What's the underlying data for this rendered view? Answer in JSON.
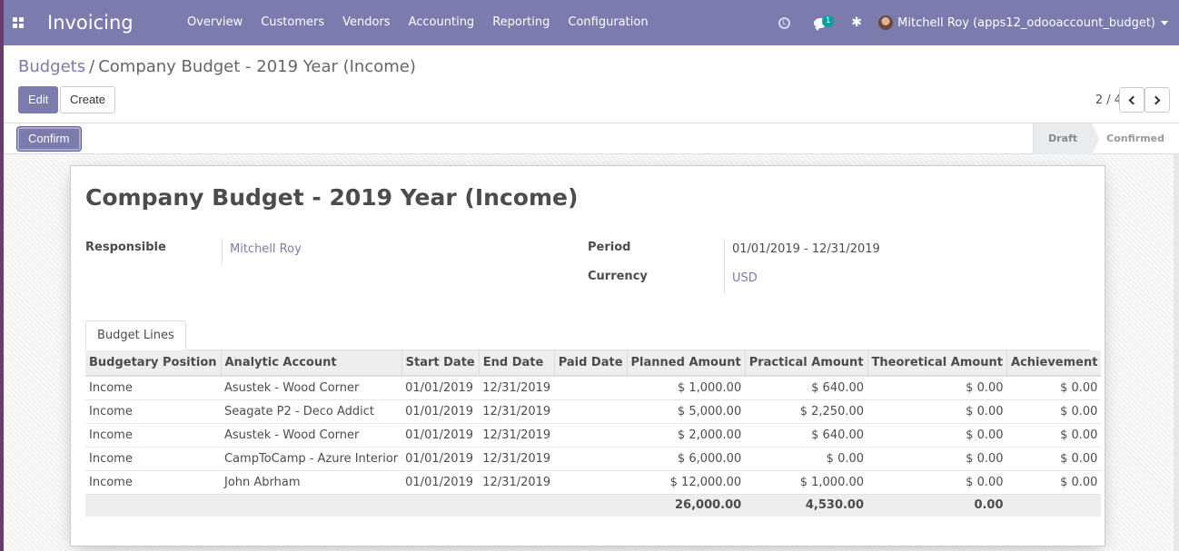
{
  "navbar": {
    "app_title": "Invoicing",
    "menu": [
      "Overview",
      "Customers",
      "Vendors",
      "Accounting",
      "Reporting",
      "Configuration"
    ],
    "messages_badge": "1",
    "user_name": "Mitchell Roy (apps12_odooaccount_budget)"
  },
  "breadcrumb": {
    "parent": "Budgets",
    "separator": "/",
    "current": "Company Budget - 2019 Year (Income)"
  },
  "actions": {
    "edit": "Edit",
    "create": "Create"
  },
  "pager": {
    "value": "2 / 4"
  },
  "statusbar": {
    "confirm": "Confirm",
    "stages": [
      "Draft",
      "Confirmed"
    ],
    "active_stage": "Draft"
  },
  "record": {
    "title": "Company Budget - 2019 Year (Income)",
    "responsible_label": "Responsible",
    "responsible_value": "Mitchell Roy",
    "period_label": "Period",
    "period_value": "01/01/2019 - 12/31/2019",
    "currency_label": "Currency",
    "currency_value": "USD"
  },
  "tabs": [
    "Budget Lines"
  ],
  "budget_lines": {
    "columns": [
      "Budgetary Position",
      "Analytic Account",
      "Start Date",
      "End Date",
      "Paid Date",
      "Planned Amount",
      "Practical Amount",
      "Theoretical Amount",
      "Achievement"
    ],
    "rows": [
      [
        "Income",
        "Asustek - Wood Corner",
        "01/01/2019",
        "12/31/2019",
        "",
        "$ 1,000.00",
        "$ 640.00",
        "$ 0.00",
        "$ 0.00"
      ],
      [
        "Income",
        "Seagate P2 - Deco Addict",
        "01/01/2019",
        "12/31/2019",
        "",
        "$ 5,000.00",
        "$ 2,250.00",
        "$ 0.00",
        "$ 0.00"
      ],
      [
        "Income",
        "Asustek - Wood Corner",
        "01/01/2019",
        "12/31/2019",
        "",
        "$ 2,000.00",
        "$ 640.00",
        "$ 0.00",
        "$ 0.00"
      ],
      [
        "Income",
        "CampToCamp - Azure Interior",
        "01/01/2019",
        "12/31/2019",
        "",
        "$ 6,000.00",
        "$ 0.00",
        "$ 0.00",
        "$ 0.00"
      ],
      [
        "Income",
        "John Abrham",
        "01/01/2019",
        "12/31/2019",
        "",
        "$ 12,000.00",
        "$ 1,000.00",
        "$ 0.00",
        "$ 0.00"
      ]
    ],
    "totals": [
      "",
      "",
      "",
      "",
      "",
      "26,000.00",
      "4,530.00",
      "0.00",
      ""
    ]
  },
  "colors": {
    "brand": "#7c7bad",
    "accent_badge": "#00a09d"
  }
}
